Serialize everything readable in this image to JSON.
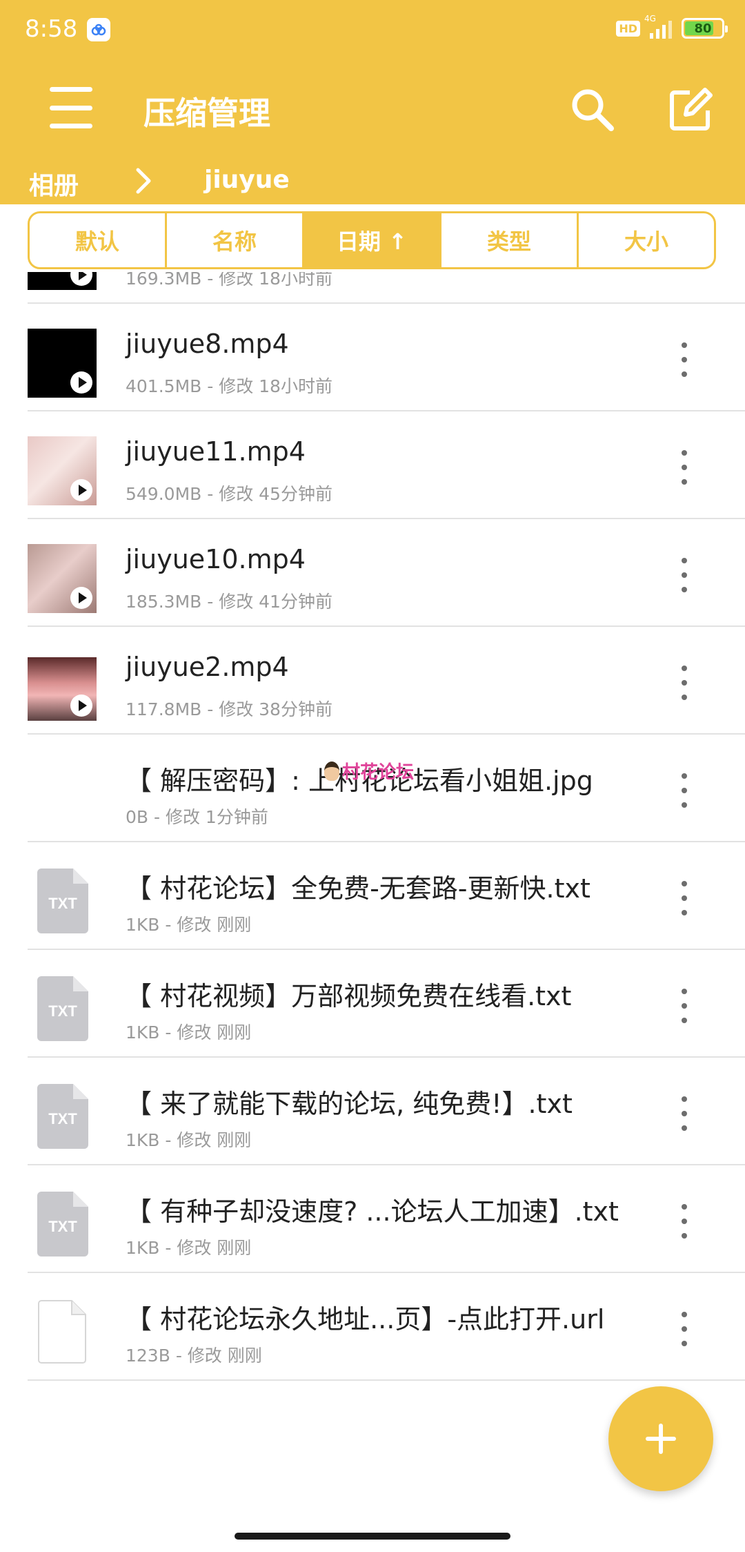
{
  "status_bar": {
    "time": "8:58",
    "hd": "HD",
    "network": "4G",
    "battery": "80",
    "battery_level": 0.8
  },
  "toolbar": {
    "title": "压缩管理"
  },
  "breadcrumb": {
    "root": "相册",
    "current": "jiuyue"
  },
  "sort_tabs": [
    {
      "label": "默认",
      "active": false
    },
    {
      "label": "名称",
      "active": false
    },
    {
      "label": "日期 ↑",
      "active": true
    },
    {
      "label": "类型",
      "active": false
    },
    {
      "label": "大小",
      "active": false
    }
  ],
  "files": [
    {
      "name": "",
      "meta": "169.3MB - 修改 18小时前",
      "kind": "video"
    },
    {
      "name": "jiuyue8.mp4",
      "meta": "401.5MB - 修改 18小时前",
      "kind": "video"
    },
    {
      "name": "jiuyue11.mp4",
      "meta": "549.0MB - 修改 45分钟前",
      "kind": "photo"
    },
    {
      "name": "jiuyue10.mp4",
      "meta": "185.3MB - 修改 41分钟前",
      "kind": "photo2"
    },
    {
      "name": "jiuyue2.mp4",
      "meta": "117.8MB - 修改 38分钟前",
      "kind": "photo3"
    },
    {
      "name": "【 解压密码】: 上村花论坛看小姐姐.jpg",
      "meta": "0B - 修改 1分钟前",
      "kind": "none"
    },
    {
      "name": "【 村花论坛】全免费-无套路-更新快.txt",
      "meta": "1KB - 修改 刚刚",
      "kind": "txt"
    },
    {
      "name": "【 村花视频】万部视频免费在线看.txt",
      "meta": "1KB - 修改 刚刚",
      "kind": "txt"
    },
    {
      "name": "【 来了就能下载的论坛, 纯免费!】.txt",
      "meta": "1KB - 修改 刚刚",
      "kind": "txt"
    },
    {
      "name": "【 有种子却没速度? ...论坛人工加速】.txt",
      "meta": "1KB - 修改 刚刚",
      "kind": "txt"
    },
    {
      "name": "【 村花论坛永久地址...页】-点此打开.url",
      "meta": "123B - 修改 刚刚",
      "kind": "file"
    }
  ],
  "file_type_label": "TXT",
  "watermark": "村花论坛",
  "colors": {
    "accent": "#F2C545",
    "text": "#222222",
    "meta": "#9a9a9a",
    "divider": "#e2e2e2"
  }
}
